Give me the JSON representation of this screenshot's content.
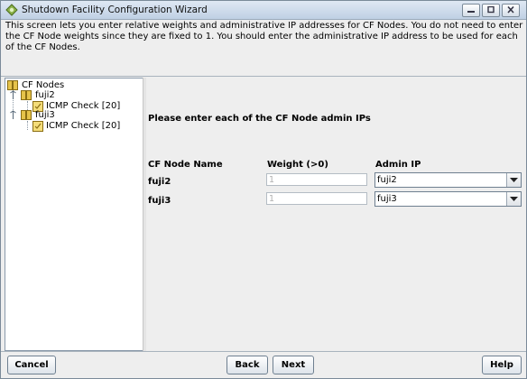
{
  "window": {
    "title": "Shutdown Facility Configuration Wizard"
  },
  "description": "This screen lets you enter relative weights and administrative IP addresses for CF Nodes. You do not need to enter the CF Node weights since they are fixed to 1. You should enter the administrative IP address to be used for each of the CF Nodes.",
  "tree": {
    "root_label": "CF Nodes",
    "nodes": [
      {
        "label": "fuji2",
        "child": "ICMP Check [20]"
      },
      {
        "label": "fuji3",
        "child": "ICMP Check [20]"
      }
    ]
  },
  "form": {
    "prompt": "Please enter each of the CF Node admin IPs",
    "headers": {
      "name": "CF Node Name",
      "weight": "Weight (>0)",
      "admin_ip": "Admin IP"
    },
    "rows": [
      {
        "name": "fuji2",
        "weight": "1",
        "admin_ip": "fuji2"
      },
      {
        "name": "fuji3",
        "weight": "1",
        "admin_ip": "fuji3"
      }
    ]
  },
  "buttons": {
    "cancel": "Cancel",
    "back": "Back",
    "next": "Next",
    "help": "Help"
  },
  "colors": {
    "titlebar": "#c8d6e6",
    "panel": "#eeeeee",
    "tree_bg": "#ffffff",
    "disabled_text": "#b0b0b0"
  },
  "icons": [
    "app-icon",
    "minimize-icon",
    "maximize-icon",
    "close-icon",
    "folder-icon",
    "node-icon",
    "expand-handle-icon",
    "dropdown-arrow-icon"
  ]
}
